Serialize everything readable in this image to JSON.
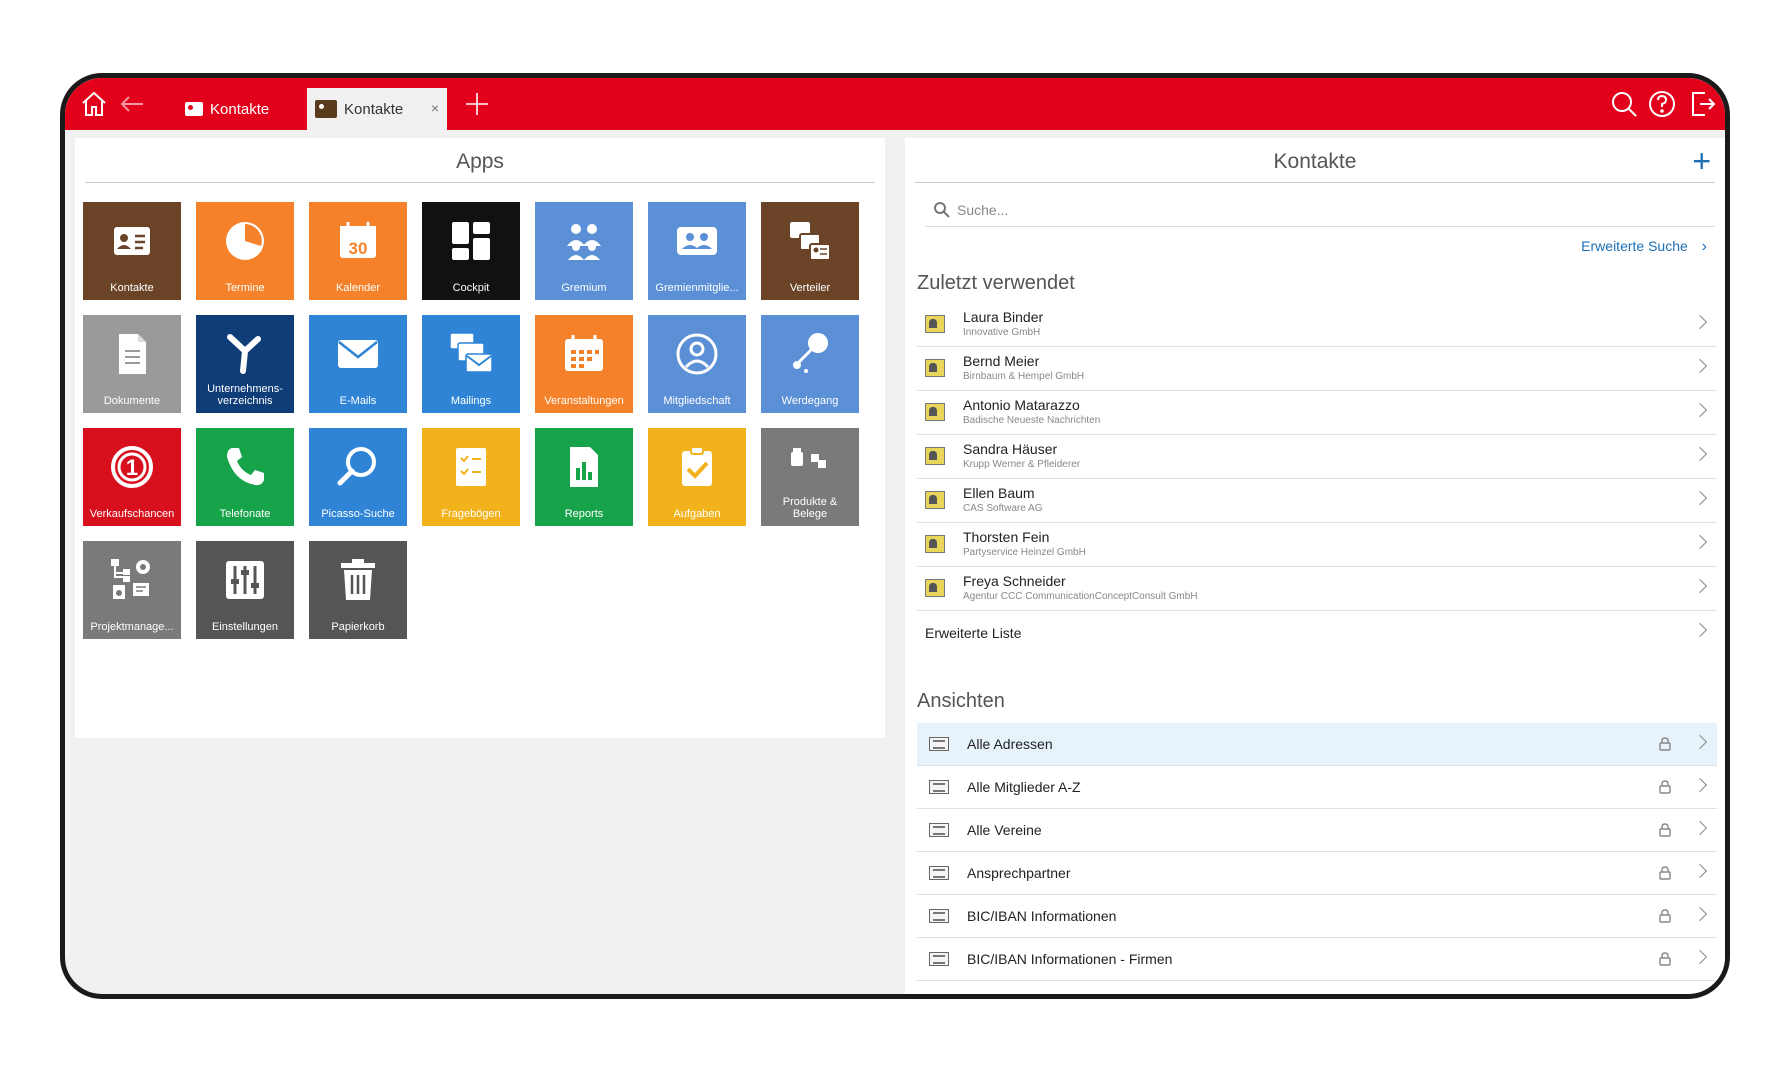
{
  "toolbar": {
    "tabs": [
      {
        "label": "Kontakte",
        "active": false
      },
      {
        "label": "Kontakte",
        "active": true,
        "close": "×"
      }
    ]
  },
  "colors": {
    "brand": "#e2001a",
    "link": "#1e6fb5",
    "selected_row": "#e6f3fb"
  },
  "apps_panel": {
    "title": "Apps",
    "apps": [
      {
        "label": "Kontakte",
        "color": "#6b4428",
        "icon": "contact-card-icon"
      },
      {
        "label": "Termine",
        "color": "#f5822a",
        "icon": "pie-clock-icon"
      },
      {
        "label": "Kalender",
        "color": "#f5822a",
        "icon": "calendar-icon"
      },
      {
        "label": "Cockpit",
        "color": "#111111",
        "icon": "dashboard-icon"
      },
      {
        "label": "Gremium",
        "color": "#5b8fd6",
        "icon": "group-icon"
      },
      {
        "label": "Gremienmitglie...",
        "color": "#5b8fd6",
        "icon": "members-card-icon"
      },
      {
        "label": "Verteiler",
        "color": "#6b4428",
        "icon": "distribution-icon"
      },
      {
        "label": "Dokumente",
        "color": "#9a9a9a",
        "icon": "document-icon"
      },
      {
        "label": "Unternehmens-\nverzeichnis",
        "color": "#0e3d78",
        "icon": "network-icon"
      },
      {
        "label": "E-Mails",
        "color": "#2f84d6",
        "icon": "envelope-icon"
      },
      {
        "label": "Mailings",
        "color": "#2f84d6",
        "icon": "mailings-icon"
      },
      {
        "label": "Veranstaltungen",
        "color": "#f5822a",
        "icon": "event-calendar-icon"
      },
      {
        "label": "Mitgliedschaft",
        "color": "#5b8fd6",
        "icon": "person-circle-icon"
      },
      {
        "label": "Werdegang",
        "color": "#5b8fd6",
        "icon": "career-icon"
      },
      {
        "label": "Verkaufschancen",
        "color": "#d8101e",
        "icon": "opportunity-icon"
      },
      {
        "label": "Telefonate",
        "color": "#17a34a",
        "icon": "phone-icon"
      },
      {
        "label": "Picasso-Suche",
        "color": "#2f84d6",
        "icon": "search-icon"
      },
      {
        "label": "Fragebögen",
        "color": "#f2b21b",
        "icon": "questionnaire-icon"
      },
      {
        "label": "Reports",
        "color": "#17a34a",
        "icon": "report-icon"
      },
      {
        "label": "Aufgaben",
        "color": "#f2b21b",
        "icon": "task-check-icon"
      },
      {
        "label": "Produkte &\nBelege",
        "color": "#7a7a7a",
        "icon": "products-icon"
      },
      {
        "label": "Projektmanage...",
        "color": "#7a7a7a",
        "icon": "project-icon"
      },
      {
        "label": "Einstellungen",
        "color": "#555555",
        "icon": "sliders-icon"
      },
      {
        "label": "Papierkorb",
        "color": "#555555",
        "icon": "trash-icon"
      }
    ]
  },
  "contacts_panel": {
    "title": "Kontakte",
    "add": "+",
    "search_placeholder": "Suche...",
    "advanced_search": "Erweiterte Suche",
    "recent_title": "Zuletzt verwendet",
    "recent": [
      {
        "name": "Laura Binder",
        "company": "Innovative GmbH"
      },
      {
        "name": "Bernd Meier",
        "company": "Birnbaum & Hempel GmbH"
      },
      {
        "name": "Antonio Matarazzo",
        "company": "Badische Neueste Nachrichten"
      },
      {
        "name": "Sandra Häuser",
        "company": "Krupp Werner & Pfleiderer"
      },
      {
        "name": "Ellen Baum",
        "company": "CAS Software AG"
      },
      {
        "name": "Thorsten Fein",
        "company": "Partyservice Heinzel GmbH"
      },
      {
        "name": "Freya Schneider",
        "company": "Agentur CCC CommunicationConceptConsult GmbH"
      }
    ],
    "extended_list": "Erweiterte Liste",
    "views_title": "Ansichten",
    "views": [
      {
        "label": "Alle Adressen",
        "selected": true
      },
      {
        "label": "Alle Mitglieder A-Z",
        "selected": false
      },
      {
        "label": "Alle Vereine",
        "selected": false
      },
      {
        "label": "Ansprechpartner",
        "selected": false
      },
      {
        "label": "BIC/IBAN Informationen",
        "selected": false
      },
      {
        "label": "BIC/IBAN Informationen - Firmen",
        "selected": false
      }
    ]
  }
}
